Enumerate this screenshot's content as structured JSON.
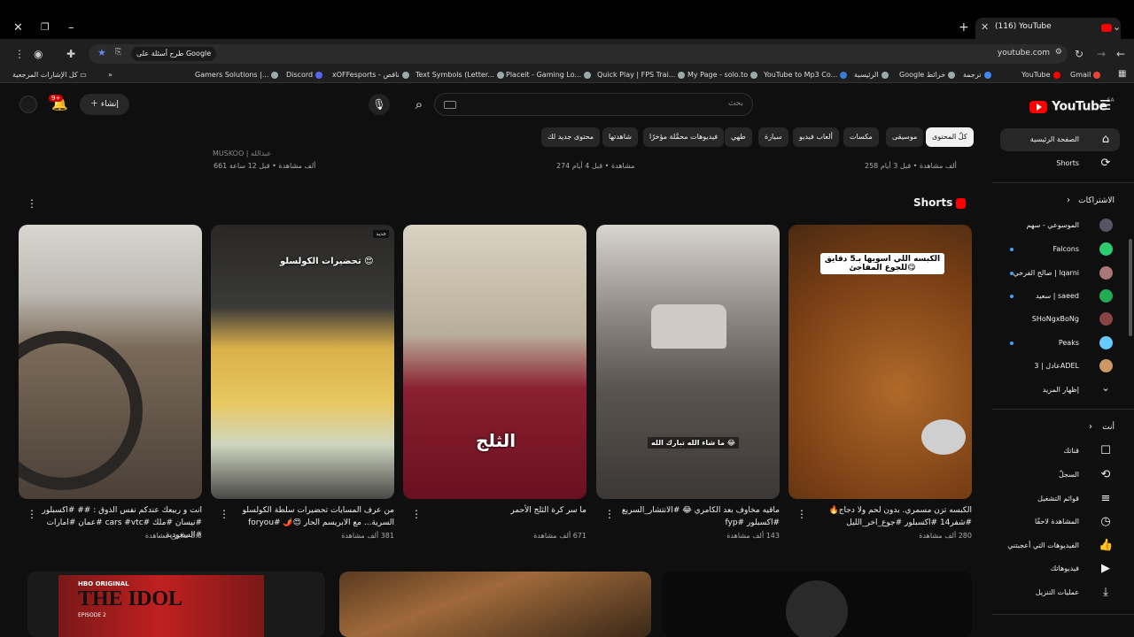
{
  "browser": {
    "tab_title": "(116) YouTube",
    "url": "youtube.com",
    "omnibox_pill": "طرح أسئلة على Google",
    "bookmarks": [
      "Gamers Solutions |...",
      "Discord",
      "xOFFesports - ناقص",
      "Text Symbols (Letter...",
      "Placeit - Gaming Lo...",
      "Quick Play | FPS Trai...",
      "My Page - solo.to",
      "YouTube to Mp3 Co...",
      "الرئيسية",
      "Google خرائط",
      "ترجمة",
      "YouTube",
      "Gmail"
    ],
    "all_bookmarks": "كل الإشارات المرجعية"
  },
  "header": {
    "logo_text": "YouTube",
    "region": "SA",
    "search_placeholder": "بحث",
    "create_label": "إنشاء",
    "notif_count": "9+"
  },
  "chips": [
    "كلّ المحتوى",
    "موسيقى",
    "مكسات",
    "ألعاب فيديو",
    "سيارة",
    "طهي",
    "فيديوهات محمَّلة مؤخرًا",
    "شاهدتها",
    "محتوى جديد لك"
  ],
  "sidebar": {
    "home": "الصفحة الرئيسية",
    "shorts": "Shorts",
    "subscriptions": "الاشتراكات",
    "channels": [
      "الموسوعي - سهم",
      "Falcons",
      "صالح الفرحي | lqarni",
      "سعيد | saeed",
      "SHoNgxBoNg",
      "Peaks",
      "عادل | 3ADEL"
    ],
    "show_more": "إظهار المزيد",
    "you": "أنت",
    "you_items": [
      "قناتك",
      "السجلّ",
      "قوائم التشغيل",
      "المشاهدة لاحقًا",
      "الفيديوهات التي أعجبتني",
      "فيديوهاتك",
      "عمليات التنزيل"
    ]
  },
  "top_row": {
    "left_channel": "MUSKOO | عبدالله",
    "left_meta": "661 ألف مشاهدة • قبل 12 ساعة",
    "mid_meta": "274 مشاهدة • قبل 4 أيام",
    "right_meta": "258 ألف مشاهدة • قبل 3 أيام"
  },
  "shorts": {
    "title": "Shorts",
    "items": [
      {
        "title": "الكبسه تزن مسمري. بدون لحم ولا دجاج🔥 #شفر14 #اكسبلور #جوع_اخر_الليل",
        "views": "280 ألف مشاهدة",
        "overlay": "الكبسه اللي اسويها بـ5 دقايق للجوع المفاجئ😋"
      },
      {
        "title": "ماقيه مخاوف بعد الكامري 😂 #الانتشار_السريع #اكسبلور #fyp",
        "views": "143 ألف مشاهدة",
        "overlay": "ما شاء الله تبارك الله 😂"
      },
      {
        "title": "ما سر كرة الثلج الأحمر",
        "views": "671 ألف مشاهدة",
        "overlay": "الثلج"
      },
      {
        "title": "من عرف المسايات تحضيرات سلطة الكولسلو السرية... مع الابريسم الحار 😍🌶️ #foryou",
        "views": "381 ألف مشاهدة",
        "overlay": "تحضيرات الكولسلو 😍",
        "badge": "جديد"
      },
      {
        "title": "انت و ربيعك عندكم نفس الذوق : ## #اكسبلور #نيسان #ملك #cars #vtc #عمان #امارات #السعودية...",
        "views": "3.3 ملايين مشاهدة"
      }
    ]
  },
  "bottom_row": {
    "hbo": "HBO ORIGINAL",
    "idol_title": "THE IDOL",
    "episode": "EPISODE 2"
  }
}
